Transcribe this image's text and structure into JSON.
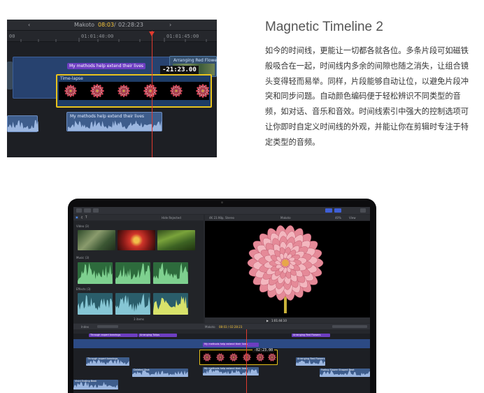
{
  "feature": {
    "title": "Magnetic Timeline 2",
    "description": "如今的时间线，更能让一切都各就各位。多条片段可如磁铁般吸合在一起，时间线内多余的间隙也随之消失，让组合镜头变得轻而易举。同样，片段能够自动让位，以避免片段冲突和同步问题。自动颜色编码便于轻松辨识不同类型的音频，如对话、音乐和音效。时间线索引中强大的控制选项可让你即时自定义时间线的外观，并能让你在剪辑时专注于特定类型的音频。"
  },
  "timeline_shot": {
    "project_name": "Makoto",
    "timecode_current": "08:03",
    "timecode_total": "02:28:23",
    "ruler_ticks": [
      "00",
      "01:01:40:00",
      "01:01:45:00"
    ],
    "drag_timecode": "-21:23.00",
    "clips": {
      "music_title_label": "My methods help extend their lives",
      "timelapse_label": "Time-lapse",
      "flowers_label": "Arranging Red Flowers",
      "audio_label": "My methods help extend their lives"
    },
    "colors": {
      "connected_clip": "#2c4a84",
      "selection": "#e8c21c",
      "audio": "#4f6d9c",
      "title_clip": "#6d3ec2",
      "playhead": "#e03a2e",
      "timecode_accent": "#f6c53c"
    }
  },
  "laptop_shot": {
    "browser": {
      "filter": "Hide Rejected",
      "sections": [
        {
          "name": "Video",
          "count": "(3)"
        },
        {
          "name": "Music",
          "count": "(3)"
        },
        {
          "name": "Effects",
          "count": "(3)"
        }
      ],
      "footer": "3 items"
    },
    "viewer": {
      "clip_name": "4K 23.98p, Stereo",
      "project": "Makoto",
      "zoom": "40%",
      "view_menu": "View",
      "timecode": "1:01:44:10"
    },
    "timeline": {
      "index_label": "Index",
      "project": "Makoto",
      "timecode": "08:03 / 02:28:23",
      "drag_timecode": "-02:23.00",
      "clip_labels": [
        "Through expert bearings",
        "Arranging Tulips",
        "Arranging Red Flowers",
        "My methods help extend their lives",
        "My methods help extend their lives",
        "Through expert bearings",
        "Deleted Shot",
        "Arranging Red Flowers",
        "Fading Flower Shaped Beat",
        "Vivid Ending Beat"
      ]
    }
  }
}
